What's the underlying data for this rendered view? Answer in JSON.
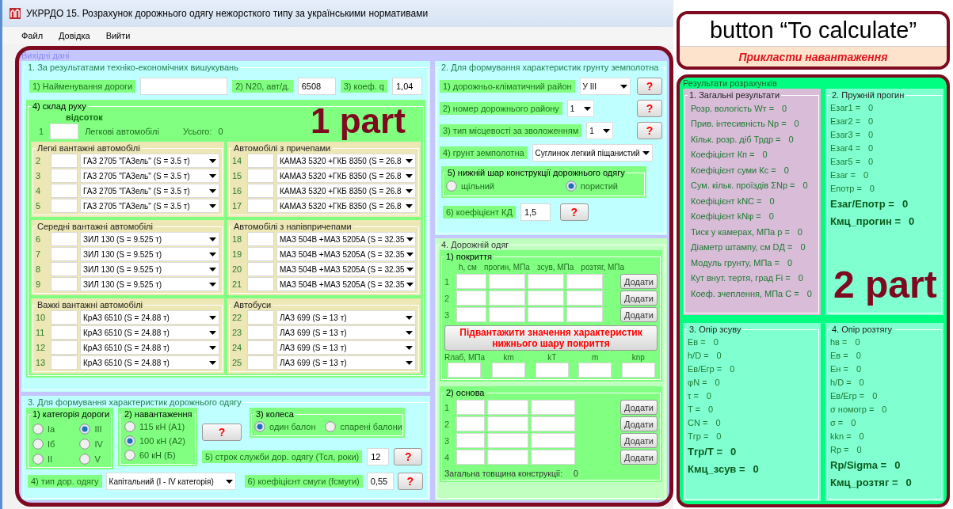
{
  "window": {
    "title": "УКРРДО 15. Розрахунок дорожнього одягу нежорсткого типу за українськими нормативами"
  },
  "menu": [
    {
      "label": "Файл"
    },
    {
      "label": "Довідка"
    },
    {
      "label": "Вийти"
    }
  ],
  "inputs": {
    "title": "Вихідні дані",
    "survey": {
      "title": "1. За результатами техніко-економічних вишукувань",
      "fields": [
        {
          "label": "1) Найменування дороги"
        },
        {
          "label": "2) N20, авт/д.",
          "value": "6508"
        },
        {
          "label": "3) коеф. q",
          "value": "1,04"
        }
      ],
      "traffic": {
        "title": "4) склад руху",
        "subtitle": "відсоток",
        "cars": {
          "number": "1",
          "label": "Легкові автомобілі",
          "total_label": "Усього:",
          "total": "0"
        },
        "groups": [
          {
            "title": "Легкі вантажні автомобілі",
            "rows": [
              {
                "number": "2",
                "vehicle": "ГАЗ 2705 \"ГАЗель\" (S = 3.5 т)"
              },
              {
                "number": "3",
                "vehicle": "ГАЗ 2705 \"ГАЗель\" (S = 3.5 т)"
              },
              {
                "number": "4",
                "vehicle": "ГАЗ 2705 \"ГАЗель\" (S = 3.5 т)"
              },
              {
                "number": "5",
                "vehicle": "ГАЗ 2705 \"ГАЗель\" (S = 3.5 т)"
              }
            ]
          },
          {
            "title": "Автомобілі з причепами",
            "rows": [
              {
                "number": "14",
                "vehicle": "КАМАЗ 5320 +ГКБ 8350 (S = 26.8"
              },
              {
                "number": "15",
                "vehicle": "КАМАЗ 5320 +ГКБ 8350 (S = 26.8"
              },
              {
                "number": "16",
                "vehicle": "КАМАЗ 5320 +ГКБ 8350 (S = 26.8"
              },
              {
                "number": "17",
                "vehicle": "КАМАЗ 5320 +ГКБ 8350 (S = 26.8"
              }
            ]
          },
          {
            "title": "Середні вантажні автомобілі",
            "rows": [
              {
                "number": "6",
                "vehicle": "ЗИЛ 130 (S = 9.525 т)"
              },
              {
                "number": "7",
                "vehicle": "ЗИЛ 130 (S = 9.525 т)"
              },
              {
                "number": "8",
                "vehicle": "ЗИЛ 130 (S = 9.525 т)"
              },
              {
                "number": "9",
                "vehicle": "ЗИЛ 130 (S = 9.525 т)"
              }
            ]
          },
          {
            "title": "Автомобілі з напівпричепами",
            "rows": [
              {
                "number": "18",
                "vehicle": "МАЗ 504В +МАЗ 5205А (S = 32.35"
              },
              {
                "number": "19",
                "vehicle": "МАЗ 504В +МАЗ 5205А (S = 32.35"
              },
              {
                "number": "20",
                "vehicle": "МАЗ 504В +МАЗ 5205А (S = 32.35"
              },
              {
                "number": "21",
                "vehicle": "МАЗ 504В +МАЗ 5205А (S = 32.35"
              }
            ]
          },
          {
            "title": "Важкі вантажні автомобілі",
            "rows": [
              {
                "number": "10",
                "vehicle": "КрАЗ 6510 (S = 24.88 т)"
              },
              {
                "number": "11",
                "vehicle": "КрАЗ 6510 (S = 24.88 т)"
              },
              {
                "number": "12",
                "vehicle": "КрАЗ 6510 (S = 24.88 т)"
              },
              {
                "number": "13",
                "vehicle": "КрАЗ 6510 (S = 24.88 т)"
              }
            ]
          },
          {
            "title": "Автобуси",
            "rows": [
              {
                "number": "22",
                "vehicle": "ЛАЗ 699 (S = 13 т)"
              },
              {
                "number": "23",
                "vehicle": "ЛАЗ 699 (S = 13 т)"
              },
              {
                "number": "24",
                "vehicle": "ЛАЗ 699 (S = 13 т)"
              },
              {
                "number": "25",
                "vehicle": "ЛАЗ 699 (S = 13 т)"
              }
            ]
          }
        ]
      }
    },
    "soil": {
      "title": "2.  Для формування характеристик грунту земполотна",
      "rows": [
        {
          "label": "1) дорожньо-кліматичний район",
          "value": "У ІІІ",
          "help": "?"
        },
        {
          "label": "2) номер дорожнього району",
          "value": "1",
          "help": "?"
        },
        {
          "label": "3) тип місцевості за зволоженням",
          "value": "1",
          "help": "?"
        },
        {
          "label": "4) грунт земполотна",
          "value": "Суглинок легкий піщанистий"
        }
      ],
      "layer": {
        "title": "5) нижній шар конструкції дорожнього одягу",
        "options": [
          {
            "label": "щільний",
            "selected": false
          },
          {
            "label": "пористий",
            "selected": true
          }
        ]
      },
      "kd": {
        "label": "6) коефіцієнт КД",
        "value": "1,5",
        "help": "?"
      }
    },
    "pavement": {
      "title": "4. Дорожній одяг",
      "coating": {
        "title": "1) покриття",
        "columns": [
          "h, см",
          "прогин, МПа",
          "зсув, МПа",
          "розтяг, МПа"
        ],
        "rows": [
          {
            "number": "1",
            "button": "Додати"
          },
          {
            "number": "2",
            "button": "Додати"
          },
          {
            "number": "3",
            "button": "Додати"
          }
        ]
      },
      "load_button": "Підвантажити значення характеристик нижнього шару покриття",
      "params": [
        {
          "label": "Rлаб, МПа"
        },
        {
          "label": "km"
        },
        {
          "label": "kT"
        },
        {
          "label": "m"
        },
        {
          "label": "knp"
        }
      ],
      "base": {
        "title": "2) основа",
        "rows": [
          {
            "number": "1",
            "button": "Додати"
          },
          {
            "number": "2",
            "button": "Додати"
          },
          {
            "number": "3",
            "button": "Додати"
          },
          {
            "number": "4",
            "button": "Додати"
          }
        ]
      },
      "total_label": "Загальна товщина конструкції:",
      "total": "0"
    },
    "design": {
      "title": "3. Для формування характеристик дорожнього одягу",
      "category": {
        "title": "1) категорія дороги",
        "options": [
          {
            "label": "Ia",
            "selected": false
          },
          {
            "label": "Iб",
            "selected": false
          },
          {
            "label": "II",
            "selected": false
          },
          {
            "label": "III",
            "selected": true
          },
          {
            "label": "IV",
            "selected": false
          },
          {
            "label": "V",
            "selected": false
          }
        ]
      },
      "load": {
        "title": "2) навантаження",
        "options": [
          {
            "label": "115 кН (А1)",
            "selected": false
          },
          {
            "label": "100 кН (А2)",
            "selected": true
          },
          {
            "label": "60 кН (Б)",
            "selected": false
          }
        ]
      },
      "help": "?",
      "wheels": {
        "title": "3) колеса",
        "options": [
          {
            "label": "один балон",
            "selected": true
          },
          {
            "label": "спарені балони",
            "selected": false
          }
        ]
      },
      "service_life": {
        "label": "5) строк служби дор. одягу (Тсл, роки)",
        "value": "12",
        "help": "?"
      },
      "pavement_type": {
        "label": "4) тип дор. одягу",
        "value": "Капітальний (І - ІV категорія)"
      },
      "lane": {
        "label": "6) коефіцієнт смуги (fсмуги)",
        "value": "0,55",
        "help": "?"
      }
    }
  },
  "calculate_button": "Прикласти навантаження",
  "results": {
    "title": "Результати розрахунків",
    "panels": [
      {
        "title": "1. Загальні результати",
        "kind": "general",
        "items": [
          {
            "kind": "plain",
            "label": "Розр. вологість Wт =",
            "value": "0"
          },
          {
            "kind": "plain",
            "label": "Прив. інтесивність Np =",
            "value": "0"
          },
          {
            "kind": "plain",
            "label": "Кільк. розр. діб Трдр =",
            "value": "0"
          },
          {
            "kind": "plain",
            "label": "Коефіцієнт  Кп =",
            "value": "0"
          },
          {
            "kind": "plain",
            "label": "Коефіцієнт суми Кс =",
            "value": "0"
          },
          {
            "kind": "plain",
            "label": "Сум. кільк. проїздів ΣNp =",
            "value": "0"
          },
          {
            "kind": "plain",
            "label": "Коефіцієнт kNC =",
            "value": "0"
          },
          {
            "kind": "plain",
            "label": "Коефіцієнт kNφ =",
            "value": "0"
          },
          {
            "kind": "plain",
            "label": "Тиск у камерах, МПа p =",
            "value": "0"
          },
          {
            "kind": "plain",
            "label": "Діаметр штампу, см DД =",
            "value": "0"
          },
          {
            "kind": "plain",
            "label": "Модуль грунту, МПа =",
            "value": "0"
          },
          {
            "kind": "plain",
            "label": "Кут внут. тертя, град Fi =",
            "value": "0"
          },
          {
            "kind": "plain",
            "label": "Коеф. зчеплення, МПа С =",
            "value": "0"
          }
        ]
      },
      {
        "title": "2. Пружній прогин",
        "kind": "detail",
        "items": [
          {
            "kind": "plain",
            "label": "Eзаг1 =",
            "value": "0"
          },
          {
            "kind": "plain",
            "label": "Eзаг2 =",
            "value": "0"
          },
          {
            "kind": "plain",
            "label": "Eзаг3 =",
            "value": "0"
          },
          {
            "kind": "plain",
            "label": "Eзаг4 =",
            "value": "0"
          },
          {
            "kind": "plain",
            "label": "Eзаг5 =",
            "value": "0"
          },
          {
            "kind": "plain",
            "label": "Eзаг =",
            "value": "0"
          },
          {
            "kind": "plain",
            "label": "Eпотр =",
            "value": "0"
          },
          {
            "kind": "key",
            "label": "Eзаг/Eпотр =",
            "value": "0"
          },
          {
            "kind": "key",
            "label": "Кмц_прогин =",
            "value": "0"
          }
        ]
      },
      {
        "title": "3. Опір зсуву",
        "kind": "detail",
        "items": [
          {
            "kind": "plain",
            "label": "Eв =",
            "value": "0"
          },
          {
            "kind": "plain",
            "label": "h/D =",
            "value": "0"
          },
          {
            "kind": "plain",
            "label": "Eв/Eгр =",
            "value": "0"
          },
          {
            "kind": "plain",
            "label": "φN =",
            "value": "0"
          },
          {
            "kind": "plain",
            "label": "τ =",
            "value": "0"
          },
          {
            "kind": "plain",
            "label": "T =",
            "value": "0"
          },
          {
            "kind": "plain",
            "label": "CN =",
            "value": "0"
          },
          {
            "kind": "plain",
            "label": "Tгр =",
            "value": "0"
          },
          {
            "kind": "key",
            "label": "Tгр/T =",
            "value": "0"
          },
          {
            "kind": "key",
            "label": "Кмц_зсув =",
            "value": "0"
          }
        ]
      },
      {
        "title": "4. Опір розтягу",
        "kind": "detail",
        "items": [
          {
            "kind": "plain",
            "label": "hв =",
            "value": "0"
          },
          {
            "kind": "plain",
            "label": "Eв =",
            "value": "0"
          },
          {
            "kind": "plain",
            "label": "Eн =",
            "value": "0"
          },
          {
            "kind": "plain",
            "label": "h/D =",
            "value": "0"
          },
          {
            "kind": "plain",
            "label": "Eв/Eгр =",
            "value": "0"
          },
          {
            "kind": "plain",
            "label": "σ номогр =",
            "value": "0"
          },
          {
            "kind": "plain",
            "label": "σ =",
            "value": "0"
          },
          {
            "kind": "plain",
            "label": "kkn =",
            "value": "0"
          },
          {
            "kind": "plain",
            "label": "Rp =",
            "value": "0"
          },
          {
            "kind": "key",
            "label": "Rp/Sigma =",
            "value": "0"
          },
          {
            "kind": "key",
            "label": "Кмц_розтяг =",
            "value": "0"
          }
        ]
      }
    ]
  },
  "annotations": [
    {
      "text": "button “To calculate”"
    },
    {
      "text": "1 part"
    },
    {
      "text": "2 part"
    }
  ]
}
